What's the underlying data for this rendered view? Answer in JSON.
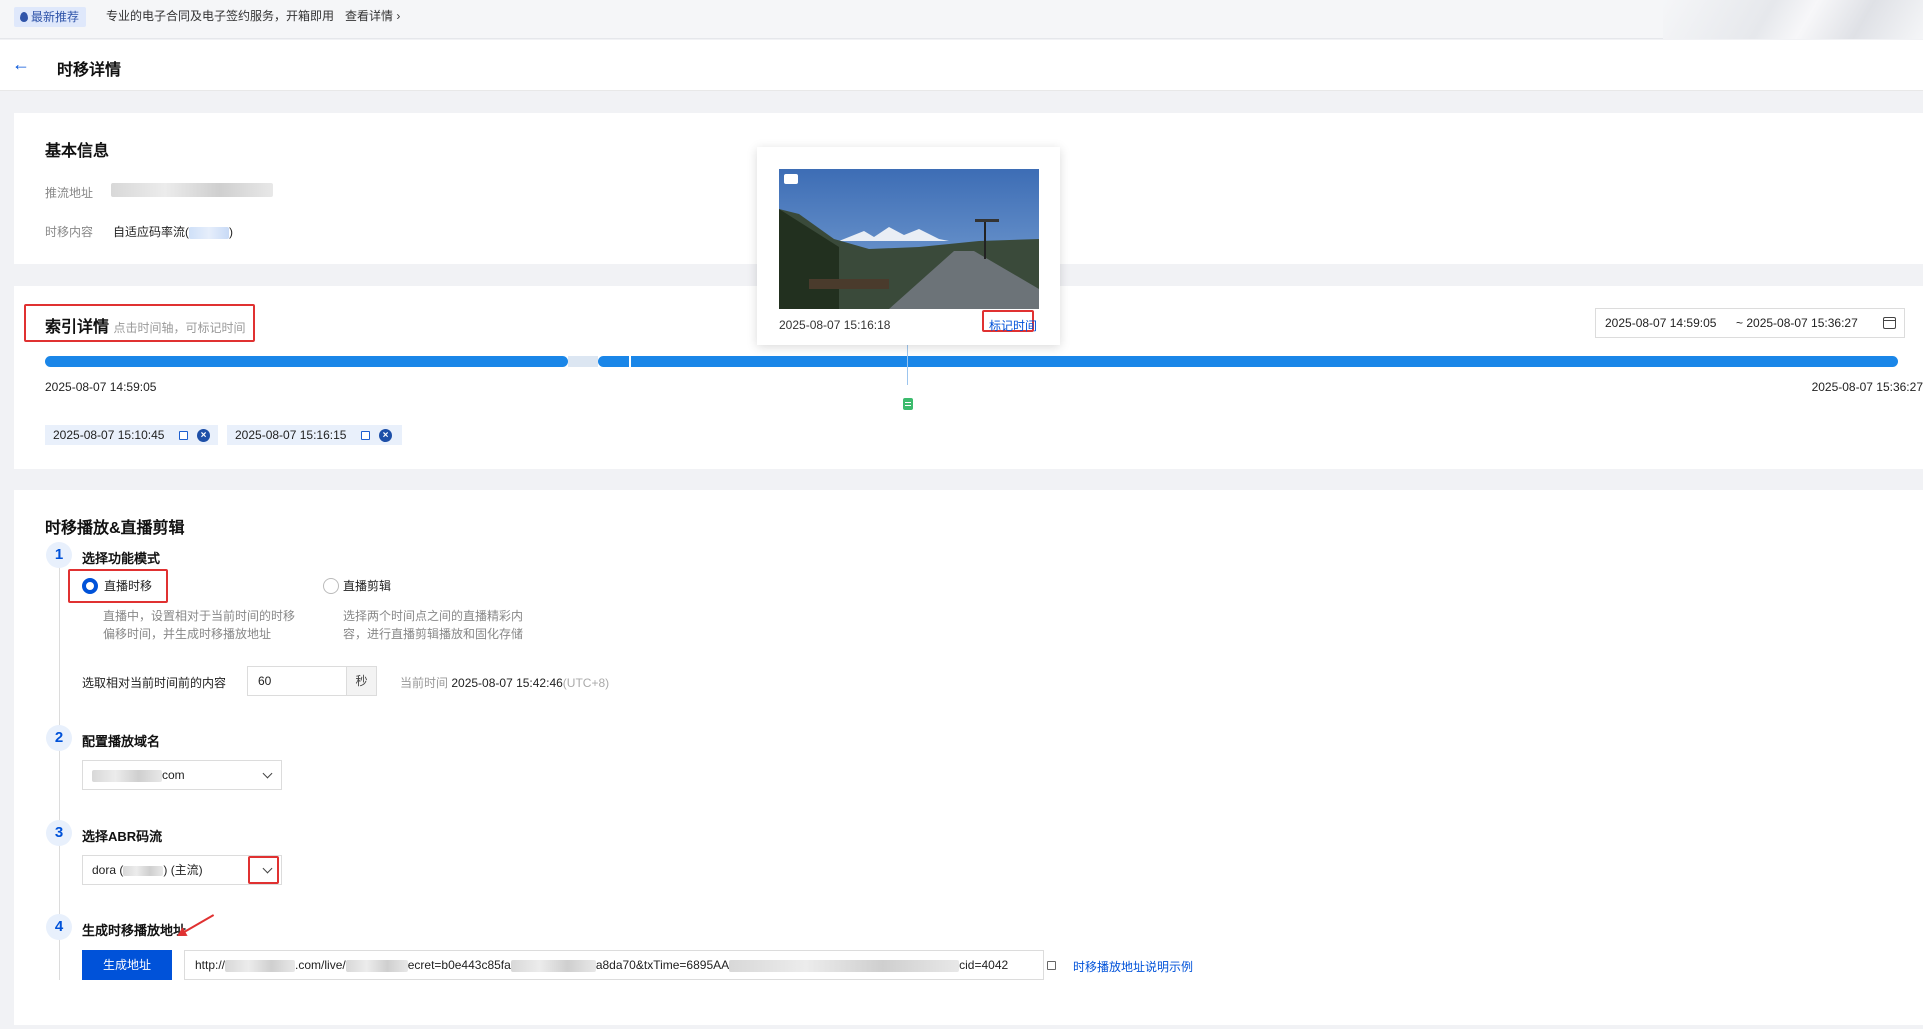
{
  "topbar": {
    "badge": "最新推荐",
    "promo": "专业的电子合同及电子签约服务，开箱即用",
    "link": "查看详情"
  },
  "header": {
    "back_icon": "arrow-left-icon",
    "title": "时移详情"
  },
  "basic_info": {
    "title": "基本信息",
    "push_label": "推流地址",
    "content_label": "时移内容",
    "content_value": "自适应码率流(",
    "content_suffix": ")"
  },
  "index": {
    "title": "索引详情",
    "hint": "点击时间轴，可标记时间",
    "range_start": "2025-08-07 14:59:05",
    "range_end": "~ 2025-08-07 15:36:27",
    "axis_start": "2025-08-07 14:59:05",
    "axis_end": "2025-08-07 15:36:27",
    "tags": [
      "2025-08-07 15:10:45",
      "2025-08-07 15:16:15"
    ],
    "popup_time": "2025-08-07 15:16:18",
    "popup_link": "标记时间"
  },
  "player": {
    "title": "时移播放&直播剪辑",
    "step1": {
      "num": "1",
      "title": "选择功能模式",
      "opt1_label": "直播时移",
      "opt1_desc1": "直播中，设置相对于当前时间的时移",
      "opt1_desc2": "偏移时间，并生成时移播放地址",
      "opt2_label": "直播剪辑",
      "opt2_desc1": "选择两个时间点之间的直播精彩内",
      "opt2_desc2": "容，进行直播剪辑播放和固化存储",
      "offset_label": "选取相对当前时间前的内容",
      "offset_value": "60",
      "offset_unit": "秒",
      "now_label": "当前时间",
      "now_value": "2025-08-07 15:42:46",
      "now_tz": "(UTC+8)"
    },
    "step2": {
      "num": "2",
      "title": "配置播放域名",
      "domain_suffix": "com"
    },
    "step3": {
      "num": "3",
      "title": "选择ABR码流",
      "stream_prefix": "dora (",
      "stream_suffix": ") (主流)"
    },
    "step4": {
      "num": "4",
      "title": "生成时移播放地址",
      "button": "生成地址",
      "url_a": "http://",
      "url_b": ".com/live/",
      "url_c": "ecret=b0e443c85fa",
      "url_d": "a8da70&txTime=6895AA",
      "url_e": "cid=4042",
      "doc_link": "时移播放地址说明示例"
    }
  }
}
